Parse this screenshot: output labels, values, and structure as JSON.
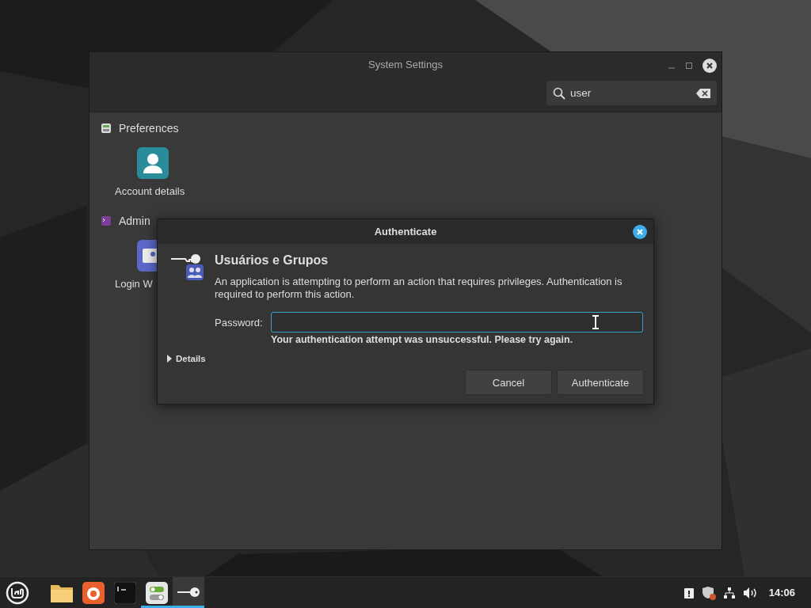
{
  "settings_window": {
    "title": "System Settings",
    "search": {
      "value": "user"
    },
    "sections": [
      {
        "kind": "preferences",
        "title": "Preferences",
        "items": [
          {
            "kind": "account",
            "label": "Account details"
          }
        ]
      },
      {
        "kind": "administration",
        "title": "Admin",
        "items": [
          {
            "kind": "login",
            "label": "Login W"
          }
        ]
      }
    ]
  },
  "auth_dialog": {
    "title": "Authenticate",
    "heading": "Usuários e Grupos",
    "message": "An application is attempting to perform an action that requires privileges. Authentication is required to perform this action.",
    "password_label": "Password:",
    "error": "Your authentication attempt was unsuccessful. Please try again.",
    "details": {
      "label": "Details",
      "expanded": false
    },
    "buttons": [
      "Cancel",
      "Authenticate"
    ]
  },
  "taskbar": {
    "apps": [
      {
        "kind": "folder",
        "running": false,
        "selected": false
      },
      {
        "kind": "browser",
        "running": false,
        "selected": false
      },
      {
        "kind": "terminal",
        "running": false,
        "selected": false
      },
      {
        "kind": "settings",
        "running": true,
        "selected": false
      },
      {
        "kind": "key",
        "running": true,
        "selected": true
      }
    ],
    "clock": "14:06"
  }
}
